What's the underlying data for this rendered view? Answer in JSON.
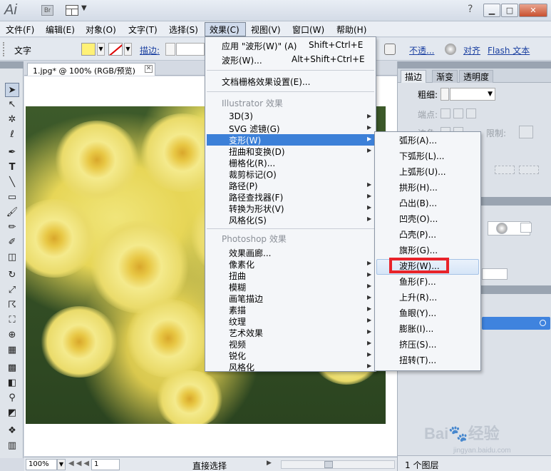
{
  "window": {
    "app_logo": "Ai",
    "bridge_logo": "Br",
    "layout_dropdown": "▼",
    "help_icon": "?",
    "buttons": {
      "minimize": "▁",
      "maximize": "□",
      "close": "✕"
    }
  },
  "menubar": [
    {
      "label": "文件(F)"
    },
    {
      "label": "编辑(E)"
    },
    {
      "label": "对象(O)"
    },
    {
      "label": "文字(T)"
    },
    {
      "label": "选择(S)"
    },
    {
      "label": "效果(C)"
    },
    {
      "label": "视图(V)"
    },
    {
      "label": "窗口(W)"
    },
    {
      "label": "帮助(H)"
    }
  ],
  "control_bar": {
    "type_label": "文字",
    "fill_color": "#fff176",
    "stroke_label": "描边:",
    "opacity_label": "不透...",
    "align_label": "对齐",
    "flash_text_label": "Flash 文本"
  },
  "document": {
    "tab_title": "1.jpg* @ 100% (RGB/预览)",
    "tab_close": "✕"
  },
  "status_bar": {
    "zoom": "100%",
    "page": "1",
    "current_tool": "直接选择"
  },
  "panels": {
    "tabs": [
      "描边",
      "渐变",
      "透明度"
    ],
    "weight_label": "粗细:",
    "cap_label": "端点:",
    "corner_label": "边角:",
    "limit_label": "限制:",
    "layers_count": "1 个图层"
  },
  "effects_menu": {
    "apply_last": {
      "label": "应用 \"波形(W)\" (A)",
      "shortcut": "Shift+Ctrl+E"
    },
    "last_effect": {
      "label": "波形(W)...",
      "shortcut": "Alt+Shift+Ctrl+E"
    },
    "raster_settings": "文档栅格效果设置(E)...",
    "illustrator_header": "Illustrator 效果",
    "illustrator_items": [
      {
        "label": "3D(3)",
        "submenu": true
      },
      {
        "label": "SVG 滤镜(G)",
        "submenu": true
      },
      {
        "label": "变形(W)",
        "submenu": true,
        "selected": true
      },
      {
        "label": "扭曲和变换(D)",
        "submenu": true
      },
      {
        "label": "栅格化(R)...",
        "submenu": false
      },
      {
        "label": "裁剪标记(O)",
        "submenu": false
      },
      {
        "label": "路径(P)",
        "submenu": true
      },
      {
        "label": "路径查找器(F)",
        "submenu": true
      },
      {
        "label": "转换为形状(V)",
        "submenu": true
      },
      {
        "label": "风格化(S)",
        "submenu": true
      }
    ],
    "photoshop_header": "Photoshop 效果",
    "photoshop_items": [
      {
        "label": "效果画廊...",
        "submenu": false
      },
      {
        "label": "像素化",
        "submenu": true
      },
      {
        "label": "扭曲",
        "submenu": true
      },
      {
        "label": "模糊",
        "submenu": true
      },
      {
        "label": "画笔描边",
        "submenu": true
      },
      {
        "label": "素描",
        "submenu": true
      },
      {
        "label": "纹理",
        "submenu": true
      },
      {
        "label": "艺术效果",
        "submenu": true
      },
      {
        "label": "视频",
        "submenu": true
      },
      {
        "label": "锐化",
        "submenu": true
      },
      {
        "label": "风格化",
        "submenu": true
      }
    ],
    "arrow": "▶"
  },
  "warp_submenu": {
    "items": [
      "弧形(A)...",
      "下弧形(L)...",
      "上弧形(U)...",
      "拱形(H)...",
      "凸出(B)...",
      "凹壳(O)...",
      "凸壳(P)...",
      "旗形(G)...",
      "波形(W)...",
      "鱼形(F)...",
      "上升(R)...",
      "鱼眼(Y)...",
      "膨胀(I)...",
      "挤压(S)...",
      "扭转(T)..."
    ],
    "highlighted_index": 8
  },
  "watermark": {
    "brand": "Baidu 经验",
    "url": "jingyan.baidu.com"
  },
  "colors": {
    "selection": "#3c80d8",
    "highlight_box": "#e8232a"
  }
}
